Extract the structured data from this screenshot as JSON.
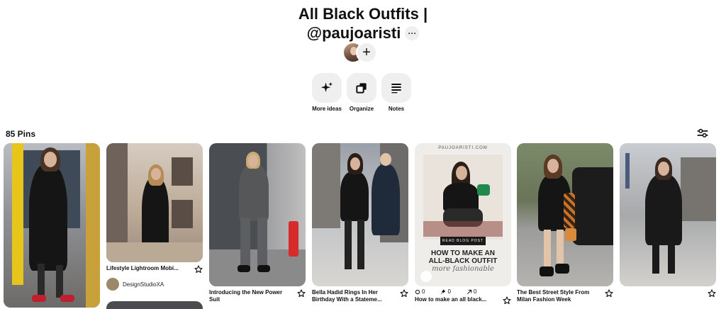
{
  "board": {
    "title_line1": "All Black Outfits |",
    "title_line2": "@paujoaristi",
    "more_label": "···",
    "add_collaborator": "+"
  },
  "actions": [
    {
      "label": "More ideas",
      "icon": "sparkle-icon"
    },
    {
      "label": "Organize",
      "icon": "organize-icon"
    },
    {
      "label": "Notes",
      "icon": "notes-icon"
    }
  ],
  "pin_count": "85 Pins",
  "pins": [
    {
      "title": "",
      "creator": ""
    },
    {
      "title": "Lifestyle Lightroom Mobi...",
      "creator": "DesignStudioXA"
    },
    {
      "title": "Introducing the New Power Suit",
      "creator": ""
    },
    {
      "title": "Bella Hadid Rings In Her Birthday With a Stateme...",
      "creator": ""
    },
    {
      "title": "How to make an all black...",
      "stats": {
        "comments": "0",
        "saves": "0",
        "shares": "0"
      },
      "overlay": {
        "site": "PAUJOARISTI.COM",
        "cta": "READ BLOG POST",
        "headline1": "HOW TO MAKE AN",
        "headline2": "ALL-BLACK OUTFIT",
        "script": "more fashionable"
      }
    },
    {
      "title": "The Best Street Style From Milan Fashion Week",
      "creator": ""
    },
    {
      "title": "",
      "creator": ""
    }
  ],
  "colors": {
    "button_bg": "#efefef",
    "text": "#111111",
    "accent_red": "#e60023"
  }
}
